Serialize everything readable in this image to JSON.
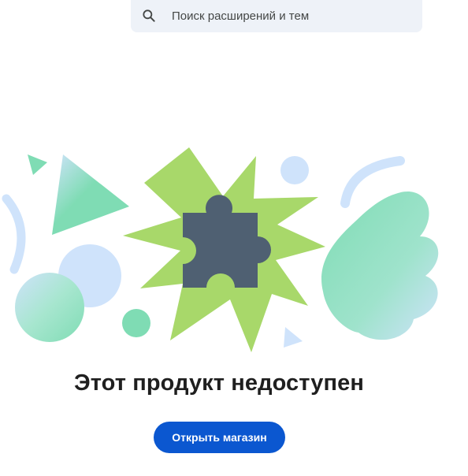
{
  "search": {
    "placeholder": "Поиск расширений и тем",
    "value": ""
  },
  "icons": {
    "search": "search-icon",
    "puzzle": "puzzle-piece-icon"
  },
  "main": {
    "title": "Этот продукт недоступен",
    "button_label": "Открыть магазин"
  },
  "colors": {
    "accent": "#0b57d0",
    "search_bg": "#eef2f8",
    "burst_green": "#a8d86a",
    "puzzle_slate": "#4f6072",
    "mint": "#7fdcb4",
    "light_blue": "#cfe3fb"
  }
}
